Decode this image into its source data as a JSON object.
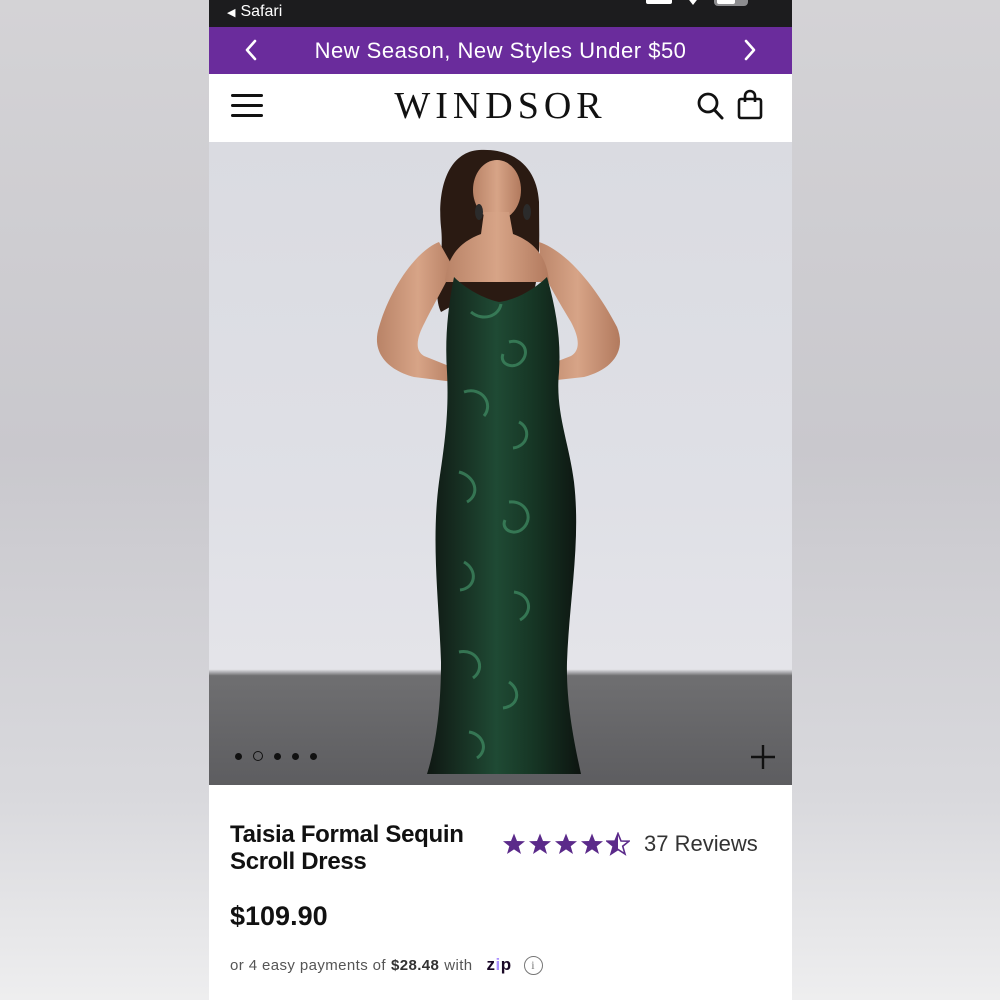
{
  "status_bar": {
    "back_app": "Safari"
  },
  "promo": {
    "text": "New Season, New Styles Under $50"
  },
  "header": {
    "logo": "WINDSOR"
  },
  "gallery": {
    "image_count": 5,
    "active_index": 1
  },
  "product": {
    "name": "Taisia Formal Sequin Scroll Dress",
    "rating": 4.5,
    "reviews": "37 Reviews",
    "price": "$109.90"
  },
  "payment": {
    "prefix": "or 4 easy payments of",
    "amount": "$28.48",
    "with": "with",
    "provider": "zip"
  },
  "colors": {
    "brand_purple": "#6a2c9c",
    "star_purple": "#5b2a8a",
    "dress_green": "#1f4a34"
  }
}
